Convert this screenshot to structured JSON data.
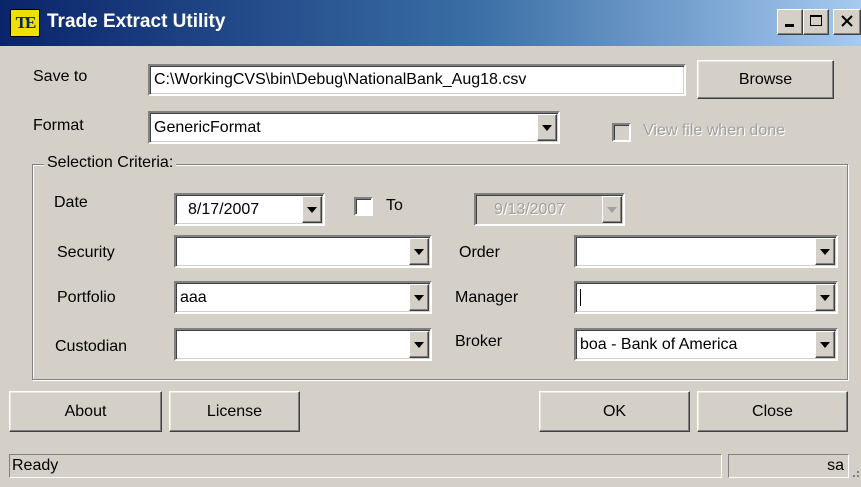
{
  "window": {
    "title": "Trade Extract Utility",
    "icon_text": "TE",
    "caption_buttons": [
      "minimize-icon",
      "maximize-icon",
      "close-icon"
    ]
  },
  "save_to": {
    "label": "Save to",
    "value": "C:\\WorkingCVS\\bin\\Debug\\NationalBank_Aug18.csv",
    "browse_label": "Browse"
  },
  "format": {
    "label": "Format",
    "value": "GenericFormat",
    "view_when_done_label": "View file when done",
    "view_when_done_checked": false
  },
  "criteria": {
    "group_label": "Selection Criteria:",
    "date_label": "Date",
    "date_from": "8/17/2007",
    "to_label": "To",
    "to_checked": false,
    "date_to": "9/13/2007",
    "security_label": "Security",
    "security_value": "",
    "order_label": "Order",
    "order_value": "",
    "portfolio_label": "Portfolio",
    "portfolio_value": "aaa",
    "manager_label": "Manager",
    "manager_value": "",
    "custodian_label": "Custodian",
    "custodian_value": "",
    "broker_label": "Broker",
    "broker_value": "boa - Bank of America"
  },
  "buttons": {
    "about": "About",
    "license": "License",
    "ok": "OK",
    "close": "Close"
  },
  "status": {
    "text": "Ready",
    "user": "sa"
  },
  "colors": {
    "face": "#d4d0c8",
    "title_start": "#0a246a",
    "title_end": "#a6caf0"
  }
}
